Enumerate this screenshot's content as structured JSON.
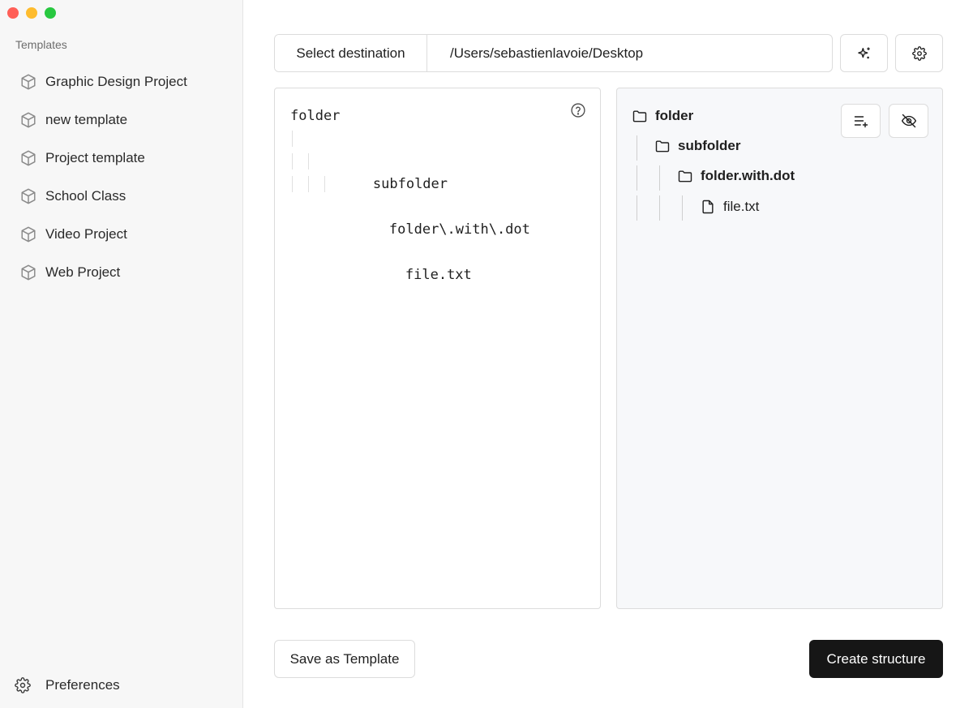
{
  "sidebar": {
    "heading": "Templates",
    "items": [
      {
        "label": "Graphic Design Project",
        "icon": "cube-icon"
      },
      {
        "label": "new template",
        "icon": "cube-icon"
      },
      {
        "label": "Project template",
        "icon": "cube-icon"
      },
      {
        "label": "School Class",
        "icon": "cube-icon"
      },
      {
        "label": "Video Project",
        "icon": "cube-icon"
      },
      {
        "label": "Web Project",
        "icon": "cube-icon"
      }
    ],
    "preferences_label": "Preferences"
  },
  "toolbar": {
    "select_destination_label": "Select destination",
    "destination_path": "/Users/sebastienlavoie/Desktop",
    "ai_icon": "sparkles-icon",
    "settings_icon": "gear-icon"
  },
  "editor": {
    "lines": [
      "folder",
      "subfolder",
      "folder\\.with\\.dot",
      "file.txt"
    ],
    "help_icon": "question-circle-icon"
  },
  "preview": {
    "tree": [
      {
        "label": "folder",
        "type": "folder"
      },
      {
        "label": "subfolder",
        "type": "folder"
      },
      {
        "label": "folder.with.dot",
        "type": "folder"
      },
      {
        "label": "file.txt",
        "type": "file"
      }
    ],
    "format_icon": "list-plus-icon",
    "visibility_icon": "eye-off-icon"
  },
  "actions": {
    "save_template_label": "Save as Template",
    "create_structure_label": "Create structure"
  },
  "colors": {
    "primary_button_bg": "#161616",
    "sidebar_bg": "#f7f7f7",
    "preview_bg": "#f7f8fa",
    "traffic_close": "#ff5f57",
    "traffic_minimize": "#febc2e",
    "traffic_maximize": "#28c840"
  }
}
